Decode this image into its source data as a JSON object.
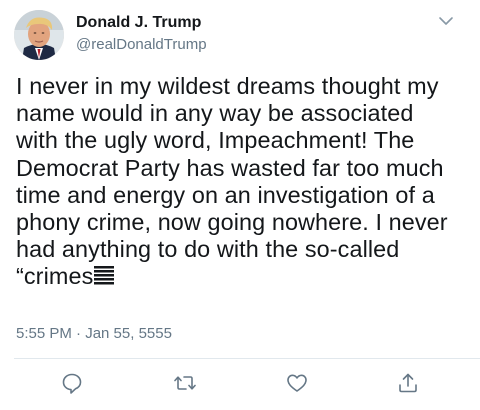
{
  "author": {
    "display_name": "Donald J. Trump",
    "handle": "@realDonaldTrump"
  },
  "tweet": {
    "text": "I never in my wildest dreams thought my\nname would in any way be associated\nwith the ugly word, Impeachment! The\nDemocrat Party has wasted far too much\ntime and energy on an investigation of a\nphony crime, now going nowhere. I never\nhad anything to do with the so-called\n“crimes",
    "timestamp": "5:55 PM · Jan 55, 5555"
  },
  "icons": {
    "avatar": "profile-photo",
    "menu": "chevron-down-icon",
    "reply": "reply-icon",
    "retweet": "retweet-icon",
    "like": "heart-icon",
    "share": "share-icon"
  },
  "colors": {
    "text": "#14171a",
    "secondary": "#657786",
    "icon": "#657786",
    "divider": "#e1e8ed"
  }
}
